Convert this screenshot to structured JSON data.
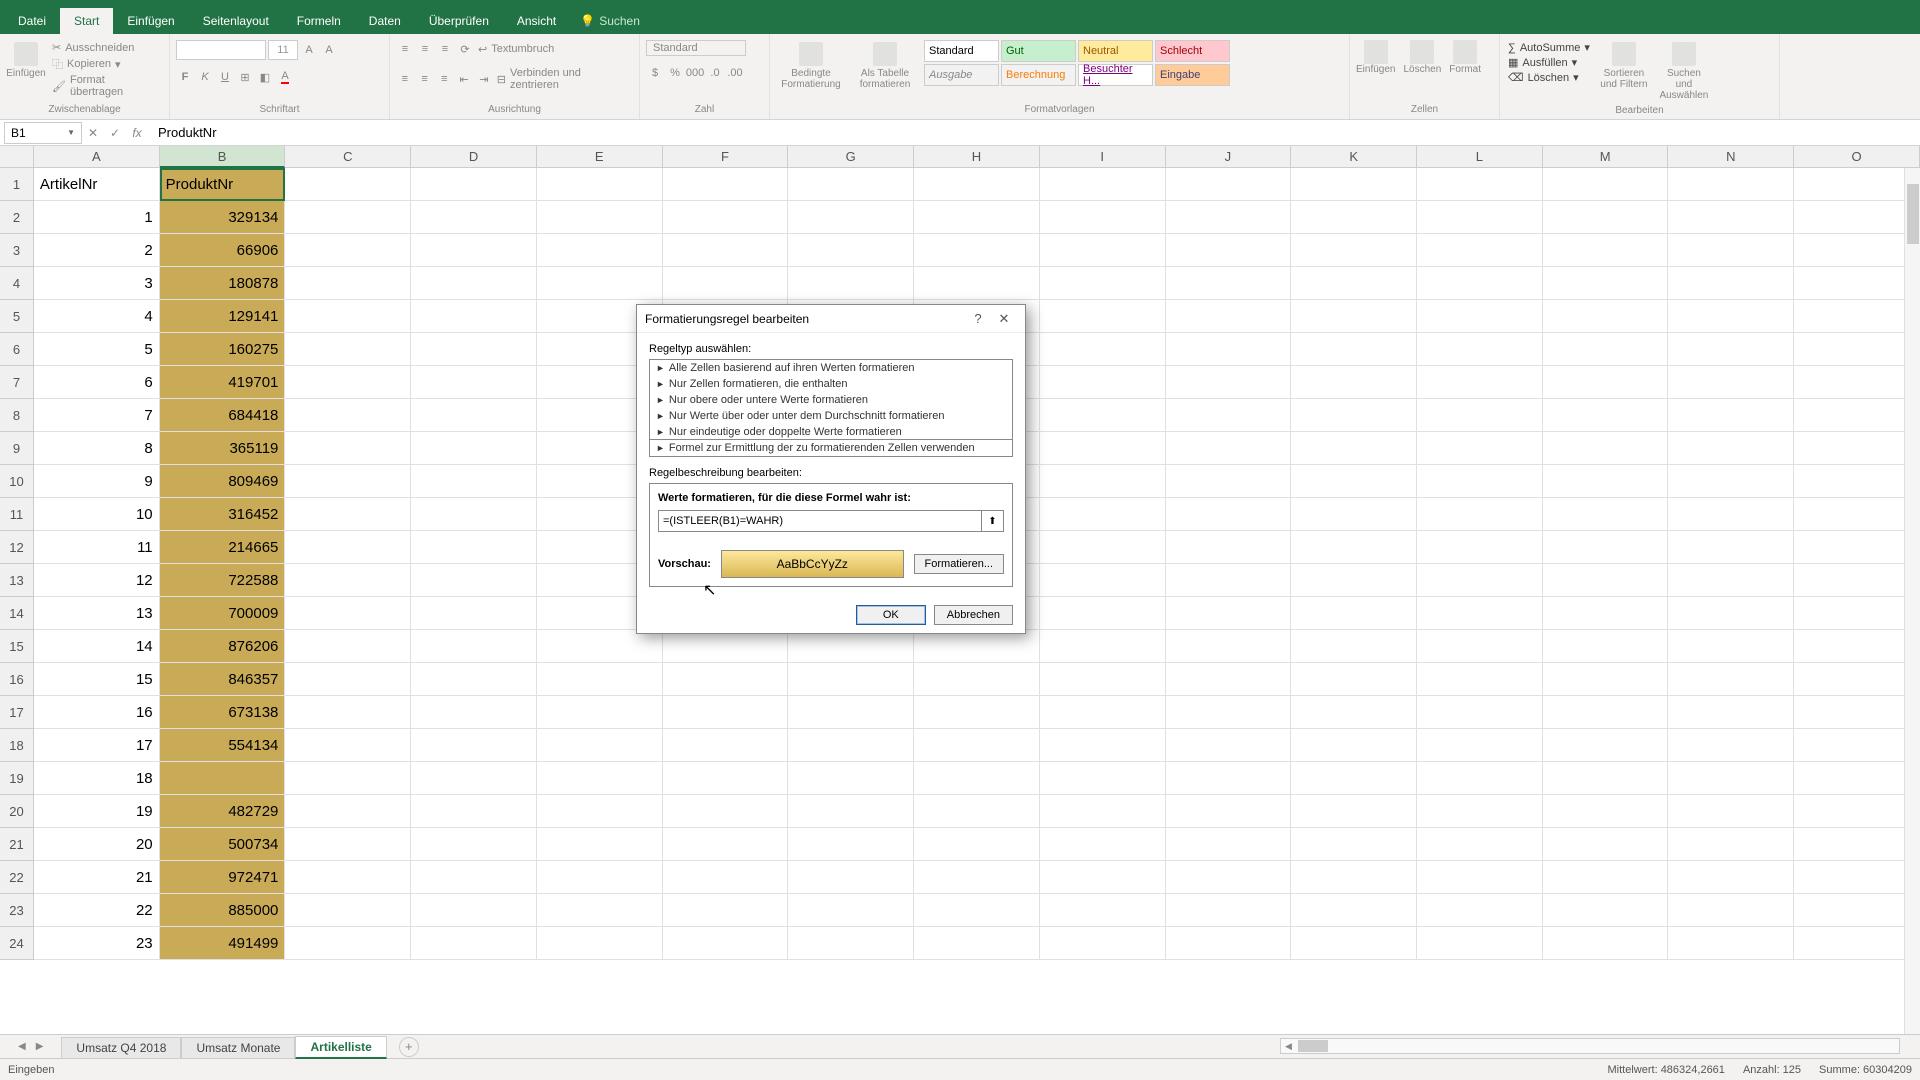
{
  "app": {
    "search_placeholder": "Suchen"
  },
  "tabs": {
    "datei": "Datei",
    "start": "Start",
    "einfuegen": "Einfügen",
    "seitenlayout": "Seitenlayout",
    "formeln": "Formeln",
    "daten": "Daten",
    "ueberpruefen": "Überprüfen",
    "ansicht": "Ansicht"
  },
  "ribbon": {
    "zwischenablage": "Zwischenablage",
    "ausschneiden": "Ausschneiden",
    "kopieren": "Kopieren",
    "format_uebertragen": "Format übertragen",
    "einfuegen": "Einfügen",
    "schriftart": "Schriftart",
    "font_size": "11",
    "ausrichtung": "Ausrichtung",
    "textumbruch": "Textumbruch",
    "verbinden": "Verbinden und zentrieren",
    "zahl": "Zahl",
    "standard": "Standard",
    "formatvorlagen": "Formatvorlagen",
    "bedingte": "Bedingte Formatierung",
    "als_tabelle": "Als Tabelle formatieren",
    "styles": {
      "standard": "Standard",
      "gut": "Gut",
      "neutral": "Neutral",
      "schlecht": "Schlecht",
      "ausgabe": "Ausgabe",
      "berechnung": "Berechnung",
      "besuchter": "Besuchter H...",
      "eingabe": "Eingabe"
    },
    "zellen": "Zellen",
    "einfuegen_z": "Einfügen",
    "loeschen_z": "Löschen",
    "format_z": "Format",
    "bearbeiten": "Bearbeiten",
    "autosumme": "AutoSumme",
    "ausfuellen": "Ausfüllen",
    "loeschen_b": "Löschen",
    "sortieren": "Sortieren und Filtern",
    "suchen": "Suchen und Auswählen"
  },
  "namebox": "B1",
  "formula": "ProduktNr",
  "columns": [
    "A",
    "B",
    "C",
    "D",
    "E",
    "F",
    "G",
    "H",
    "I",
    "J",
    "K",
    "L",
    "M",
    "N",
    "O"
  ],
  "headers": {
    "a": "ArtikelNr",
    "b": "ProduktNr"
  },
  "rows": [
    {
      "n": "1",
      "a": "1",
      "b": "329134"
    },
    {
      "n": "2",
      "a": "2",
      "b": "66906"
    },
    {
      "n": "3",
      "a": "3",
      "b": "180878"
    },
    {
      "n": "4",
      "a": "4",
      "b": "129141"
    },
    {
      "n": "5",
      "a": "5",
      "b": "160275"
    },
    {
      "n": "6",
      "a": "6",
      "b": "419701"
    },
    {
      "n": "7",
      "a": "7",
      "b": "684418"
    },
    {
      "n": "8",
      "a": "8",
      "b": "365119"
    },
    {
      "n": "9",
      "a": "9",
      "b": "809469"
    },
    {
      "n": "10",
      "a": "10",
      "b": "316452"
    },
    {
      "n": "11",
      "a": "11",
      "b": "214665"
    },
    {
      "n": "12",
      "a": "12",
      "b": "722588"
    },
    {
      "n": "13",
      "a": "13",
      "b": "700009"
    },
    {
      "n": "14",
      "a": "14",
      "b": "876206"
    },
    {
      "n": "15",
      "a": "15",
      "b": "846357"
    },
    {
      "n": "16",
      "a": "16",
      "b": "673138"
    },
    {
      "n": "17",
      "a": "17",
      "b": "554134"
    },
    {
      "n": "18",
      "a": "18",
      "b": ""
    },
    {
      "n": "19",
      "a": "19",
      "b": "482729"
    },
    {
      "n": "20",
      "a": "20",
      "b": "500734"
    },
    {
      "n": "21",
      "a": "21",
      "b": "972471"
    },
    {
      "n": "22",
      "a": "22",
      "b": "885000"
    },
    {
      "n": "23",
      "a": "23",
      "b": "491499"
    }
  ],
  "sheets": {
    "s1": "Umsatz Q4 2018",
    "s2": "Umsatz Monate",
    "s3": "Artikelliste"
  },
  "status": {
    "mode": "Eingeben",
    "mittelwert": "Mittelwert: 486324,2661",
    "anzahl": "Anzahl: 125",
    "summe": "Summe: 60304209"
  },
  "dialog": {
    "title": "Formatierungsregel bearbeiten",
    "regeltyp": "Regeltyp auswählen:",
    "rules": {
      "r1": "Alle Zellen basierend auf ihren Werten formatieren",
      "r2": "Nur Zellen formatieren, die enthalten",
      "r3": "Nur obere oder untere Werte formatieren",
      "r4": "Nur Werte über oder unter dem Durchschnitt formatieren",
      "r5": "Nur eindeutige oder doppelte Werte formatieren",
      "r6": "Formel zur Ermittlung der zu formatierenden Zellen verwenden"
    },
    "regelbeschreibung": "Regelbeschreibung bearbeiten:",
    "werte_formatieren": "Werte formatieren, für die diese Formel wahr ist:",
    "formula_value": "=(ISTLEER(B1)=WAHR)",
    "vorschau": "Vorschau:",
    "preview_text": "AaBbCcYyZz",
    "formatieren": "Formatieren...",
    "ok": "OK",
    "abbrechen": "Abbrechen"
  }
}
